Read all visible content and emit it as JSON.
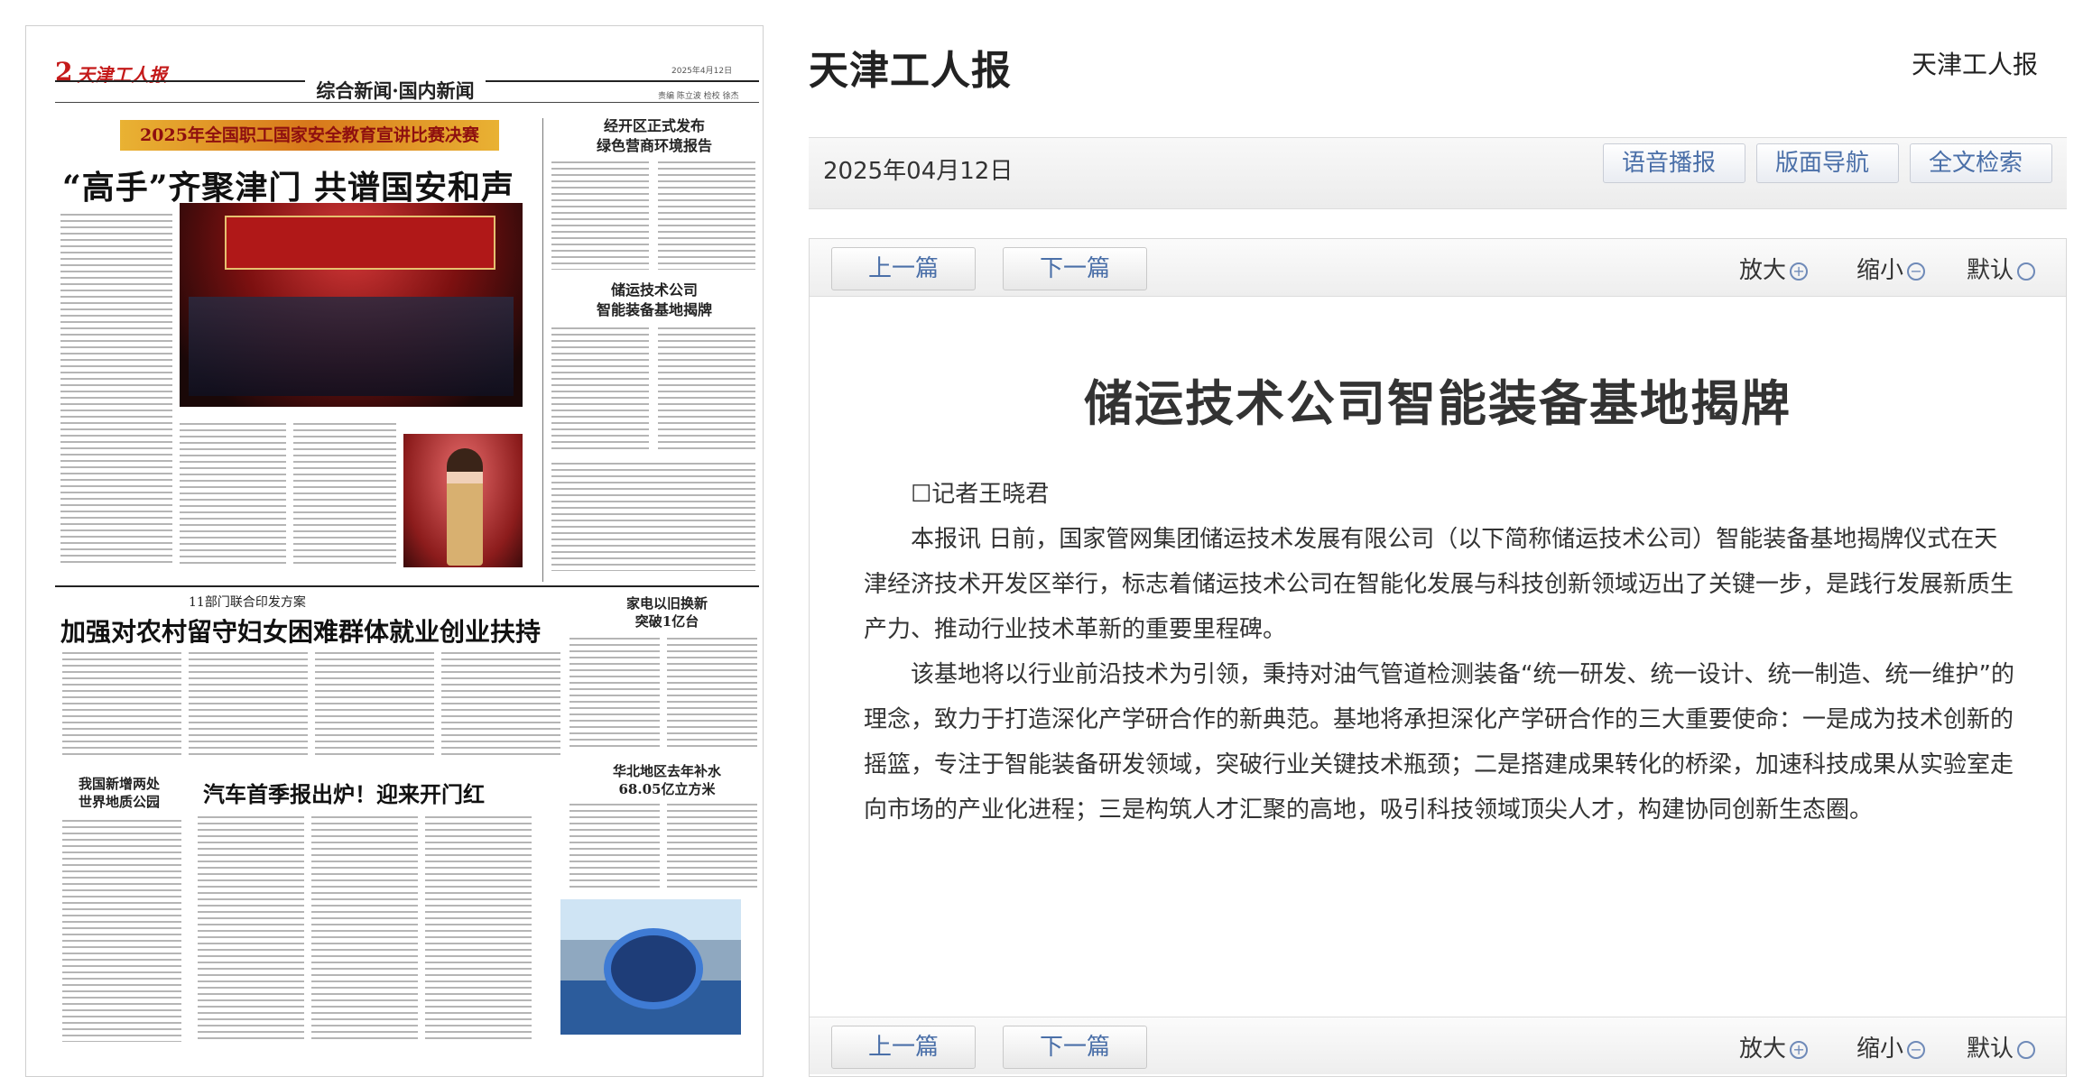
{
  "newspaper": {
    "page_num": "2",
    "mast_name": "天津工人报",
    "date": "2025年4月12日",
    "section": "综合新闻·国内新闻",
    "editors": "责编 陈立波 检校 徐杰",
    "banner": "2025年全国职工国家安全教育宣讲比赛决赛",
    "lead_head": "“高手”齐聚津门 共谱国安和声",
    "side1_head": "经开区正式发布\n绿色营商环境报告",
    "side2_head": "储运技术公司\n智能装备基地揭牌",
    "mid_sub": "11部门联合印发方案",
    "mid_head": "加强对农村留守妇女困难群体就业创业扶持",
    "side3_head": "家电以旧换新\n突破1亿台",
    "side4_head": "华北地区去年补水\n68.05亿立方米",
    "low_head_left": "我国新增两处\n世界地质公园",
    "low_head_mid": "汽车首季报出炉！迎来开门红"
  },
  "reader": {
    "brand": "天津工人报",
    "brand_right": "天津工人报",
    "issue_date": "2025年04月12日",
    "btn_audio": "语音播报",
    "btn_nav": "版面导航",
    "btn_search": "全文检索",
    "prev": "上一篇",
    "next": "下一篇",
    "zoom_in": "放大",
    "zoom_out": "缩小",
    "zoom_default": "默认",
    "article": {
      "title": "储运技术公司智能装备基地揭牌",
      "reporter": "☐记者王晓君",
      "paragraphs": [
        "本报讯 日前，国家管网集团储运技术发展有限公司（以下简称储运技术公司）智能装备基地揭牌仪式在天津经济技术开发区举行，标志着储运技术公司在智能化发展与科技创新领域迈出了关键一步，是践行发展新质生产力、推动行业技术革新的重要里程碑。",
        "该基地将以行业前沿技术为引领，秉持对油气管道检测装备“统一研发、统一设计、统一制造、统一维护”的理念，致力于打造深化产学研合作的新典范。基地将承担深化产学研合作的三大重要使命：一是成为技术创新的摇篮，专注于智能装备研发领域，突破行业关键技术瓶颈；二是搭建成果转化的桥梁，加速科技成果从实验室走向市场的产业化进程；三是构筑人才汇聚的高地，吸引科技领域顶尖人才，构建协同创新生态圈。"
      ]
    }
  }
}
